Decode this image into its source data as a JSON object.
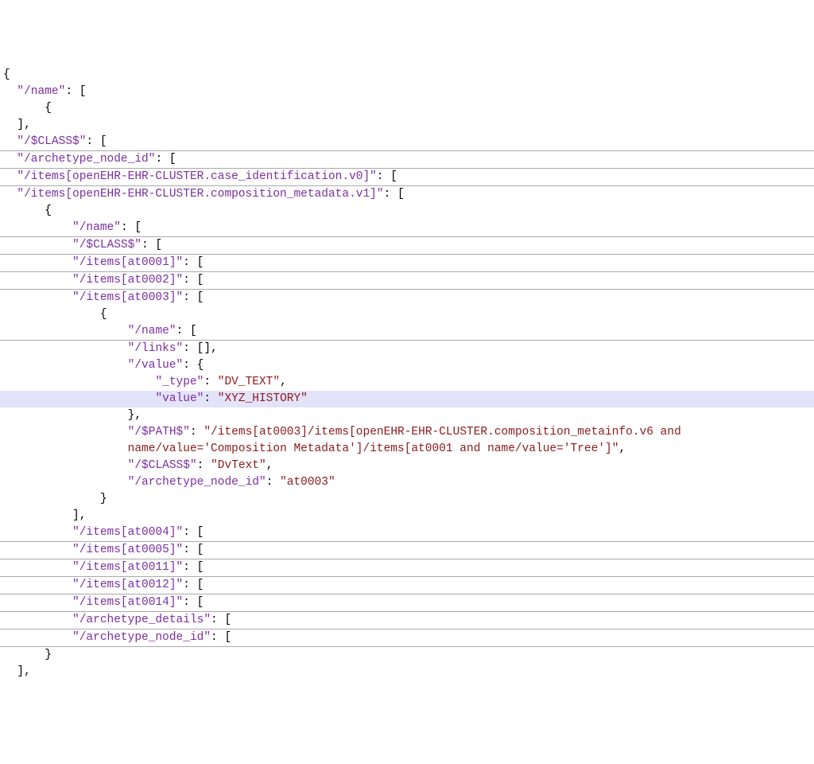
{
  "lines": [
    {
      "indent": 0,
      "border": false,
      "hl": false,
      "parts": [
        {
          "t": "{",
          "c": "punc"
        }
      ]
    },
    {
      "indent": 1,
      "border": false,
      "hl": false,
      "parts": [
        {
          "t": "\"/name\"",
          "c": "key"
        },
        {
          "t": ": [",
          "c": "punc"
        }
      ]
    },
    {
      "indent": 3,
      "border": false,
      "hl": false,
      "parts": [
        {
          "t": "{",
          "c": "punc"
        }
      ]
    },
    {
      "indent": 1,
      "border": false,
      "hl": false,
      "parts": [
        {
          "t": "],",
          "c": "punc"
        }
      ]
    },
    {
      "indent": 1,
      "border": true,
      "hl": false,
      "parts": [
        {
          "t": "\"/$CLASS$\"",
          "c": "key"
        },
        {
          "t": ": [",
          "c": "punc"
        }
      ]
    },
    {
      "indent": 1,
      "border": true,
      "hl": false,
      "parts": [
        {
          "t": "\"/archetype_node_id\"",
          "c": "key"
        },
        {
          "t": ": [",
          "c": "punc"
        }
      ]
    },
    {
      "indent": 1,
      "border": true,
      "hl": false,
      "parts": [
        {
          "t": "\"/items[openEHR-EHR-CLUSTER.case_identification.v0]\"",
          "c": "key"
        },
        {
          "t": ": [",
          "c": "punc"
        }
      ]
    },
    {
      "indent": 1,
      "border": false,
      "hl": false,
      "parts": [
        {
          "t": "\"/items[openEHR-EHR-CLUSTER.composition_metadata.v1]\"",
          "c": "key"
        },
        {
          "t": ": [",
          "c": "punc"
        }
      ]
    },
    {
      "indent": 3,
      "border": false,
      "hl": false,
      "parts": [
        {
          "t": "{",
          "c": "punc"
        }
      ]
    },
    {
      "indent": 5,
      "border": true,
      "hl": false,
      "parts": [
        {
          "t": "\"/name\"",
          "c": "key"
        },
        {
          "t": ": [",
          "c": "punc"
        }
      ]
    },
    {
      "indent": 5,
      "border": true,
      "hl": false,
      "parts": [
        {
          "t": "\"/$CLASS$\"",
          "c": "key"
        },
        {
          "t": ": [",
          "c": "punc"
        }
      ]
    },
    {
      "indent": 5,
      "border": true,
      "hl": false,
      "parts": [
        {
          "t": "\"/items[at0001]\"",
          "c": "key"
        },
        {
          "t": ": [",
          "c": "punc"
        }
      ]
    },
    {
      "indent": 5,
      "border": true,
      "hl": false,
      "parts": [
        {
          "t": "\"/items[at0002]\"",
          "c": "key"
        },
        {
          "t": ": [",
          "c": "punc"
        }
      ]
    },
    {
      "indent": 5,
      "border": false,
      "hl": false,
      "parts": [
        {
          "t": "\"/items[at0003]\"",
          "c": "key"
        },
        {
          "t": ": [",
          "c": "punc"
        }
      ]
    },
    {
      "indent": 7,
      "border": false,
      "hl": false,
      "parts": [
        {
          "t": "{",
          "c": "punc"
        }
      ]
    },
    {
      "indent": 9,
      "border": true,
      "hl": false,
      "parts": [
        {
          "t": "\"/name\"",
          "c": "key"
        },
        {
          "t": ": [",
          "c": "punc"
        }
      ]
    },
    {
      "indent": 9,
      "border": false,
      "hl": false,
      "parts": [
        {
          "t": "\"/links\"",
          "c": "key"
        },
        {
          "t": ": [],",
          "c": "punc"
        }
      ]
    },
    {
      "indent": 9,
      "border": false,
      "hl": false,
      "parts": [
        {
          "t": "\"/value\"",
          "c": "key"
        },
        {
          "t": ": {",
          "c": "punc"
        }
      ]
    },
    {
      "indent": 11,
      "border": false,
      "hl": false,
      "parts": [
        {
          "t": "\"_type\"",
          "c": "key"
        },
        {
          "t": ": ",
          "c": "punc"
        },
        {
          "t": "\"DV_TEXT\"",
          "c": "str"
        },
        {
          "t": ",",
          "c": "punc"
        }
      ]
    },
    {
      "indent": 11,
      "border": false,
      "hl": true,
      "parts": [
        {
          "t": "\"value\"",
          "c": "key"
        },
        {
          "t": ": ",
          "c": "punc"
        },
        {
          "t": "\"XYZ_HISTORY\"",
          "c": "str"
        }
      ]
    },
    {
      "indent": 9,
      "border": false,
      "hl": false,
      "parts": [
        {
          "t": "},",
          "c": "punc"
        }
      ]
    },
    {
      "indent": 9,
      "border": false,
      "hl": false,
      "parts": [
        {
          "t": "\"/$PATH$\"",
          "c": "key"
        },
        {
          "t": ": ",
          "c": "punc"
        },
        {
          "t": "\"/items[at0003]/items[openEHR-EHR-CLUSTER.composition_metainfo.v6 and",
          "c": "str"
        }
      ]
    },
    {
      "indent": 9,
      "border": false,
      "hl": false,
      "parts": [
        {
          "t": "name/value='Composition Metadata']/items[at0001 and name/value='Tree']\"",
          "c": "str"
        },
        {
          "t": ",",
          "c": "punc"
        }
      ]
    },
    {
      "indent": 9,
      "border": false,
      "hl": false,
      "parts": [
        {
          "t": "\"/$CLASS$\"",
          "c": "key"
        },
        {
          "t": ": ",
          "c": "punc"
        },
        {
          "t": "\"DvText\"",
          "c": "str"
        },
        {
          "t": ",",
          "c": "punc"
        }
      ]
    },
    {
      "indent": 9,
      "border": false,
      "hl": false,
      "parts": [
        {
          "t": "\"/archetype_node_id\"",
          "c": "key"
        },
        {
          "t": ": ",
          "c": "punc"
        },
        {
          "t": "\"at0003\"",
          "c": "str"
        }
      ]
    },
    {
      "indent": 7,
      "border": false,
      "hl": false,
      "parts": [
        {
          "t": "}",
          "c": "punc"
        }
      ]
    },
    {
      "indent": 5,
      "border": false,
      "hl": false,
      "parts": [
        {
          "t": "],",
          "c": "punc"
        }
      ]
    },
    {
      "indent": 5,
      "border": true,
      "hl": false,
      "parts": [
        {
          "t": "\"/items[at0004]\"",
          "c": "key"
        },
        {
          "t": ": [",
          "c": "punc"
        }
      ]
    },
    {
      "indent": 5,
      "border": true,
      "hl": false,
      "parts": [
        {
          "t": "\"/items[at0005]\"",
          "c": "key"
        },
        {
          "t": ": [",
          "c": "punc"
        }
      ]
    },
    {
      "indent": 5,
      "border": true,
      "hl": false,
      "parts": [
        {
          "t": "\"/items[at0011]\"",
          "c": "key"
        },
        {
          "t": ": [",
          "c": "punc"
        }
      ]
    },
    {
      "indent": 5,
      "border": true,
      "hl": false,
      "parts": [
        {
          "t": "\"/items[at0012]\"",
          "c": "key"
        },
        {
          "t": ": [",
          "c": "punc"
        }
      ]
    },
    {
      "indent": 5,
      "border": true,
      "hl": false,
      "parts": [
        {
          "t": "\"/items[at0014]\"",
          "c": "key"
        },
        {
          "t": ": [",
          "c": "punc"
        }
      ]
    },
    {
      "indent": 5,
      "border": true,
      "hl": false,
      "parts": [
        {
          "t": "\"/archetype_details\"",
          "c": "key"
        },
        {
          "t": ": [",
          "c": "punc"
        }
      ]
    },
    {
      "indent": 5,
      "border": true,
      "hl": false,
      "parts": [
        {
          "t": "\"/archetype_node_id\"",
          "c": "key"
        },
        {
          "t": ": [",
          "c": "punc"
        }
      ]
    },
    {
      "indent": 3,
      "border": false,
      "hl": false,
      "parts": [
        {
          "t": "}",
          "c": "punc"
        }
      ]
    },
    {
      "indent": 1,
      "border": false,
      "hl": false,
      "parts": [
        {
          "t": "],",
          "c": "punc"
        }
      ]
    }
  ]
}
